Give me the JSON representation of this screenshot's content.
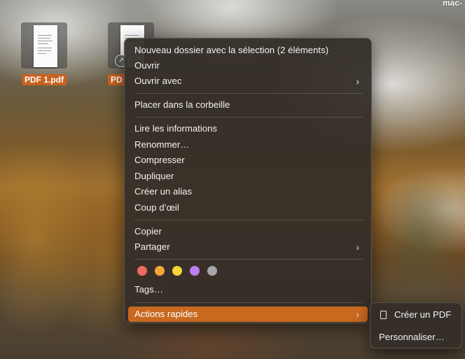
{
  "desktop": {
    "corner_label": "mac-",
    "files": [
      {
        "label": "PDF 1.pdf",
        "icon": "pdf-document-icon"
      },
      {
        "label": "PD",
        "icon": "pdf-document-icon",
        "alias_badge": "alias-arrow-icon"
      }
    ]
  },
  "context_menu": {
    "items": [
      {
        "label": "Nouveau dossier avec la sélection (2 éléments)"
      },
      {
        "label": "Ouvrir"
      },
      {
        "label": "Ouvrir avec",
        "submenu": true
      },
      {
        "label": "Placer dans la corbeille"
      },
      {
        "label": "Lire les informations"
      },
      {
        "label": "Renommer…"
      },
      {
        "label": "Compresser"
      },
      {
        "label": "Dupliquer"
      },
      {
        "label": "Créer un alias"
      },
      {
        "label": "Coup d’œil"
      },
      {
        "label": "Copier"
      },
      {
        "label": "Partager",
        "submenu": true
      },
      {
        "label": "Tags…"
      },
      {
        "label": "Actions rapides",
        "submenu": true,
        "highlighted": true
      }
    ],
    "tag_colors": [
      "#ee6a64",
      "#f6a73a",
      "#f5d638",
      "#bf7ff0",
      "#a6a6a8"
    ],
    "chevron": "›"
  },
  "submenu": {
    "items": [
      {
        "label": "Créer un PDF",
        "icon": "document-icon"
      },
      {
        "label": "Personnaliser…"
      }
    ]
  },
  "colors": {
    "highlight": "#c8691f",
    "file_label_bg": "#c8611f"
  }
}
